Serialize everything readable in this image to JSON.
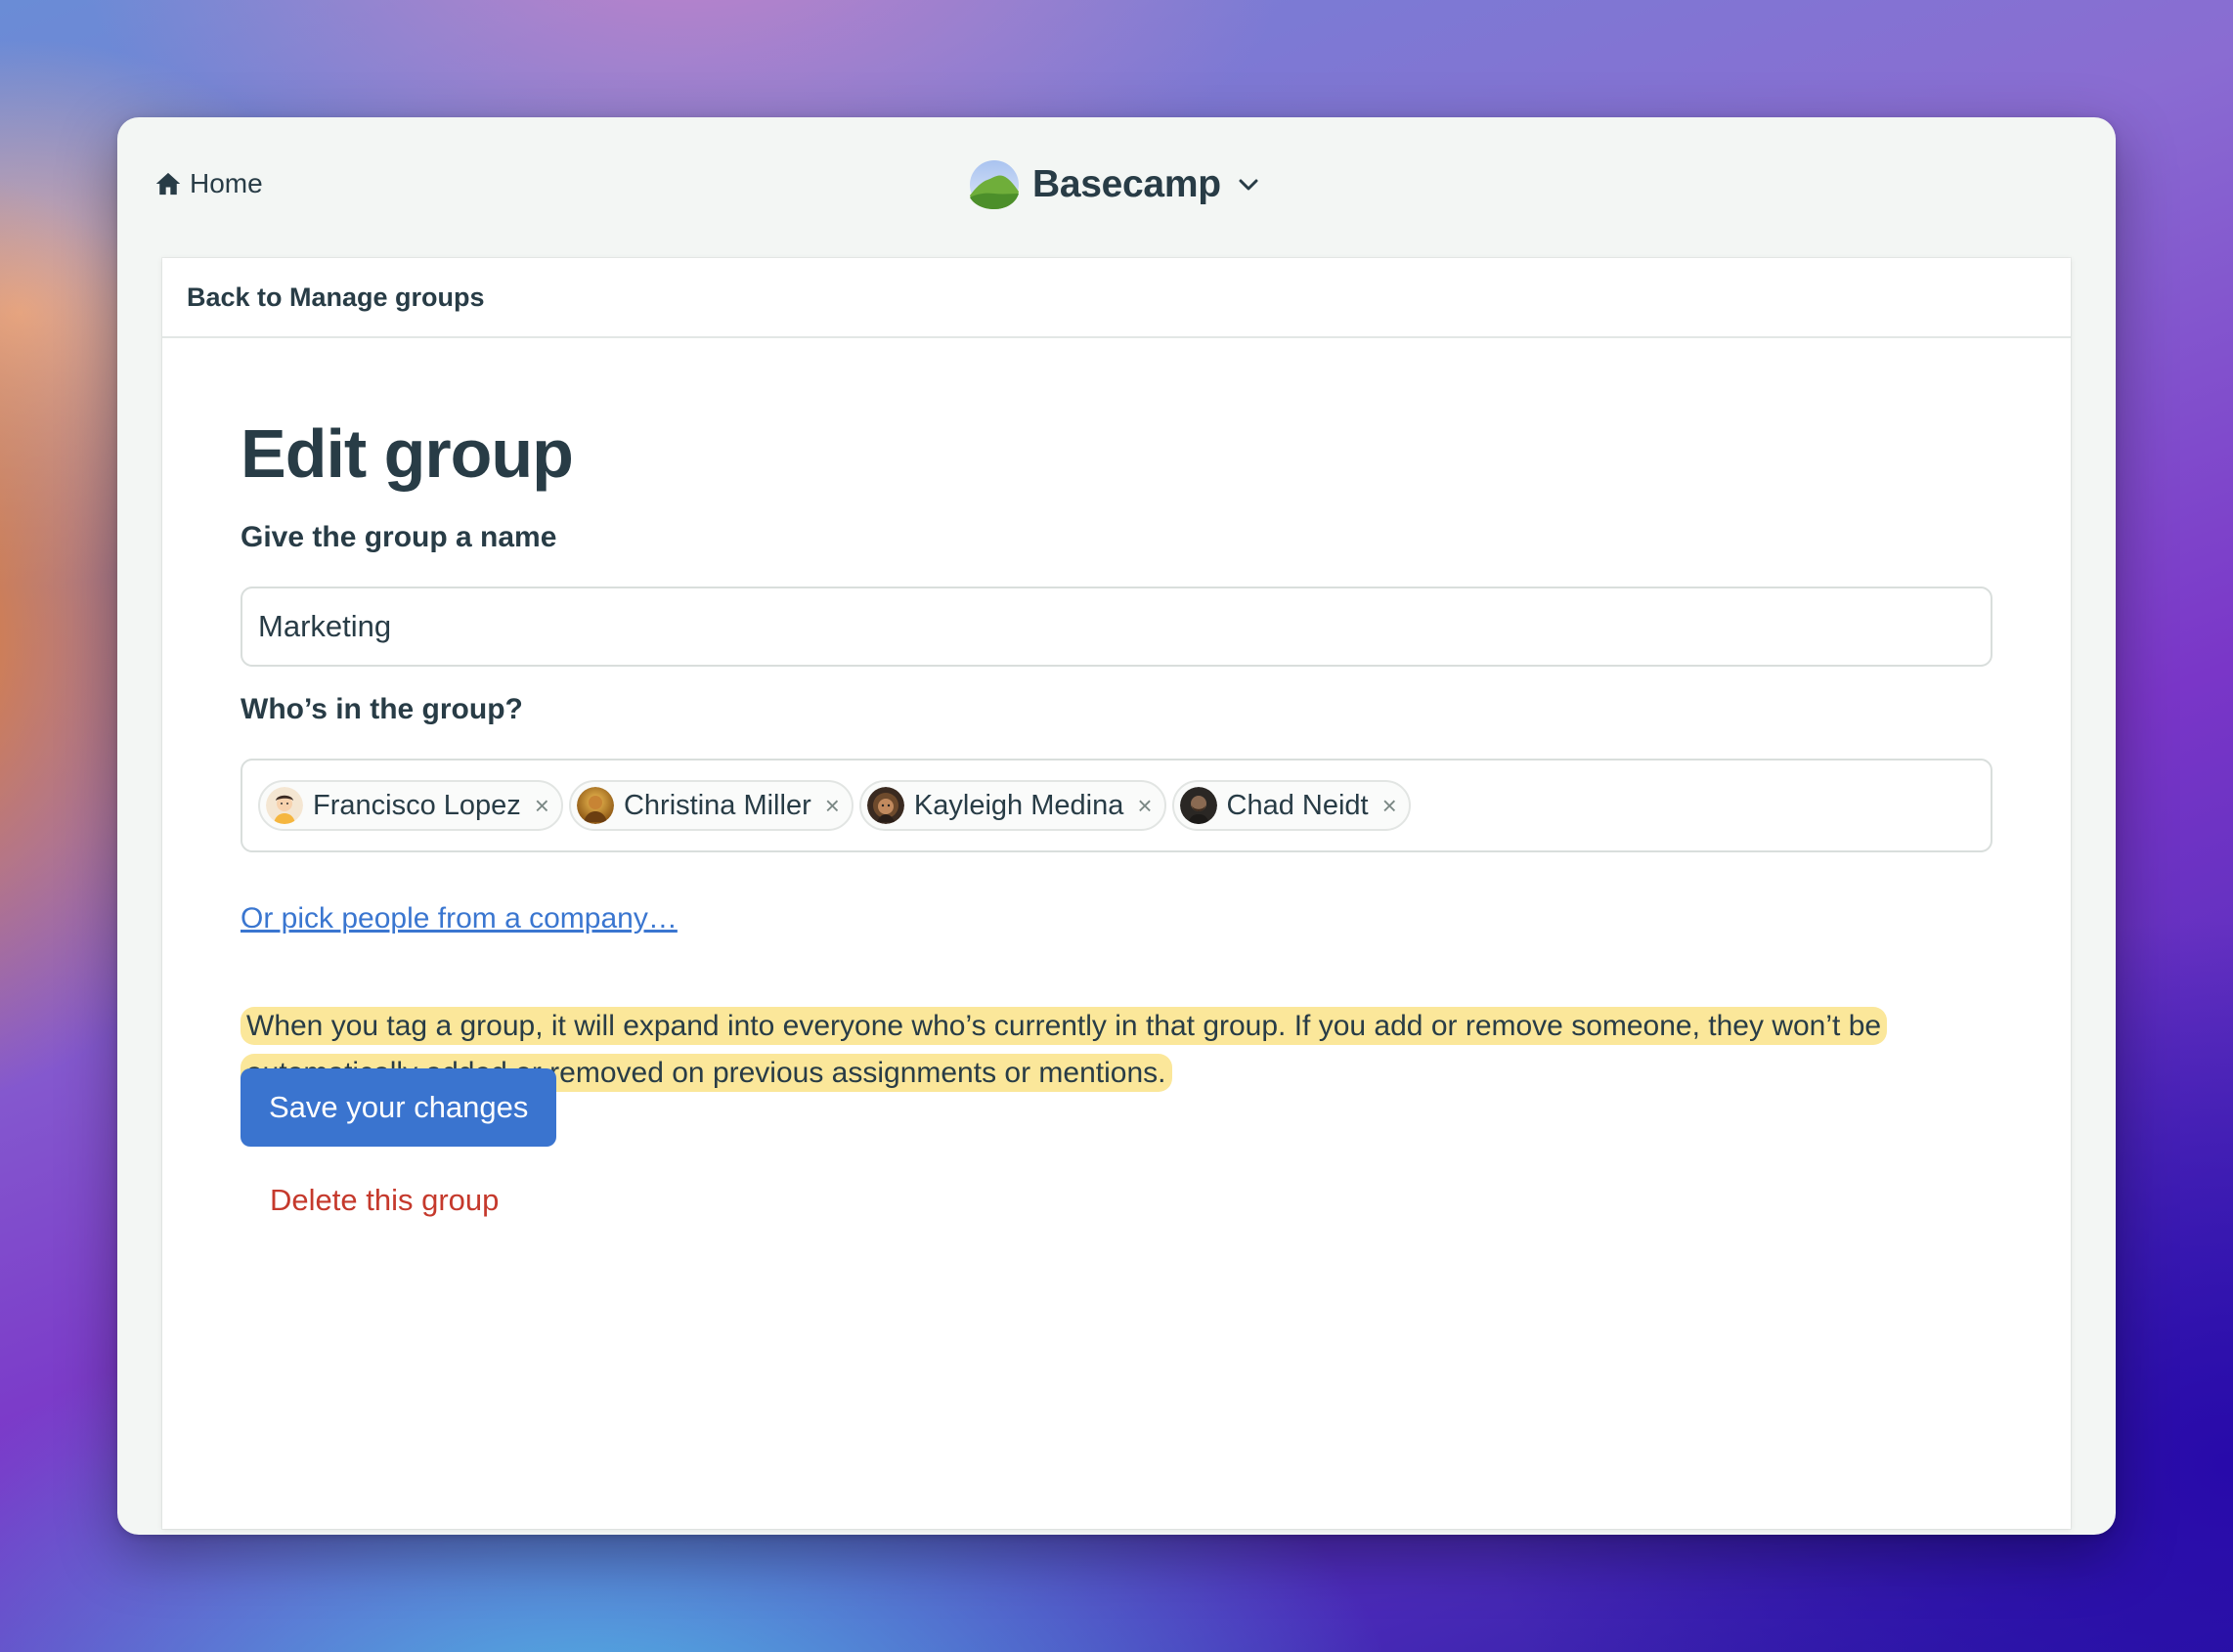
{
  "topbar": {
    "home_label": "Home",
    "brand_name": "Basecamp"
  },
  "card": {
    "back_label": "Back to Manage groups"
  },
  "form": {
    "title": "Edit group",
    "name_label": "Give the group a name",
    "name_value": "Marketing",
    "people_label": "Who’s in the group?",
    "people": [
      {
        "name": "Francisco Lopez",
        "avatar": "cartoon-avatar-icon"
      },
      {
        "name": "Christina Miller",
        "avatar": "photo-avatar-gold"
      },
      {
        "name": "Kayleigh Medina",
        "avatar": "photo-avatar-curly"
      },
      {
        "name": "Chad Neidt",
        "avatar": "photo-avatar-dark"
      }
    ],
    "remove_glyph": "×",
    "company_link": "Or pick people from a company…",
    "notice": "When you tag a group, it will expand into everyone who’s currently in that group. If you add or remove someone, they won’t be automatically added or removed on previous assignments or mentions.",
    "save_label": "Save your changes",
    "delete_label": "Delete this group"
  },
  "colors": {
    "accent": "#3a74cf",
    "danger": "#c5392c",
    "highlight": "#fbe79a",
    "text": "#283c46"
  }
}
